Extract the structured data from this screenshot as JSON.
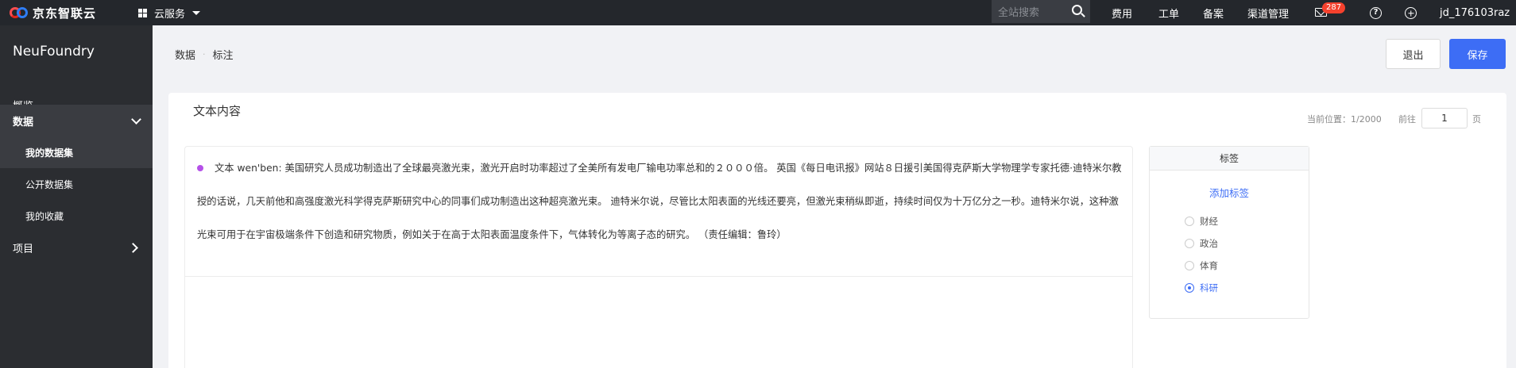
{
  "topbar": {
    "logo_text": "京东智联云",
    "cloud_service": "云服务",
    "search_placeholder": "全站搜索",
    "nav": [
      "费用",
      "工单",
      "备案",
      "渠道管理"
    ],
    "mail_badge": "287",
    "help_symbol": "?",
    "user": "jd_176103raz",
    "colors": {
      "bar": "#24272c",
      "badge": "#f5412d"
    }
  },
  "sidebar": {
    "title": "NeuFoundry",
    "items": [
      {
        "label": "概览"
      },
      {
        "label": "数据"
      },
      {
        "label": "我的数据集"
      },
      {
        "label": "公开数据集"
      },
      {
        "label": "我的收藏"
      },
      {
        "label": "项目"
      }
    ]
  },
  "header": {
    "breadcrumb": [
      "数据",
      "标注"
    ],
    "breadcrumb_sep": "·",
    "exit_label": "退出",
    "save_label": "保存",
    "accent": "#3d6df5"
  },
  "content": {
    "title": "文本内容",
    "pager": {
      "position": "当前位置：1/2000",
      "go_label": "前往",
      "page_value": "1",
      "page_unit": "页"
    },
    "text": "文本 wen'ben: 美国研究人员成功制造出了全球最亮激光束，激光开启时功率超过了全美所有发电厂输电功率总和的２０００倍。 英国《每日电讯报》网站８日援引美国得克萨斯大学物理学专家托德·迪特米尔教授的话说，几天前他和高强度激光科学得克萨斯研究中心的同事们成功制造出这种超亮激光束。 迪特米尔说，尽管比太阳表面的光线还要亮，但激光束稍纵即逝，持续时间仅为十万亿分之一秒。迪特米尔说，这种激光束可用于在宇宙极端条件下创造和研究物质，例如关于在高于太阳表面温度条件下，气体转化为等离子态的研究。 （责任编辑：鲁玲）"
  },
  "tags": {
    "header": "标签",
    "add_label": "添加标签",
    "options": [
      {
        "label": "财经",
        "checked": false
      },
      {
        "label": "政治",
        "checked": false
      },
      {
        "label": "体育",
        "checked": false
      },
      {
        "label": "科研",
        "checked": true
      }
    ]
  }
}
